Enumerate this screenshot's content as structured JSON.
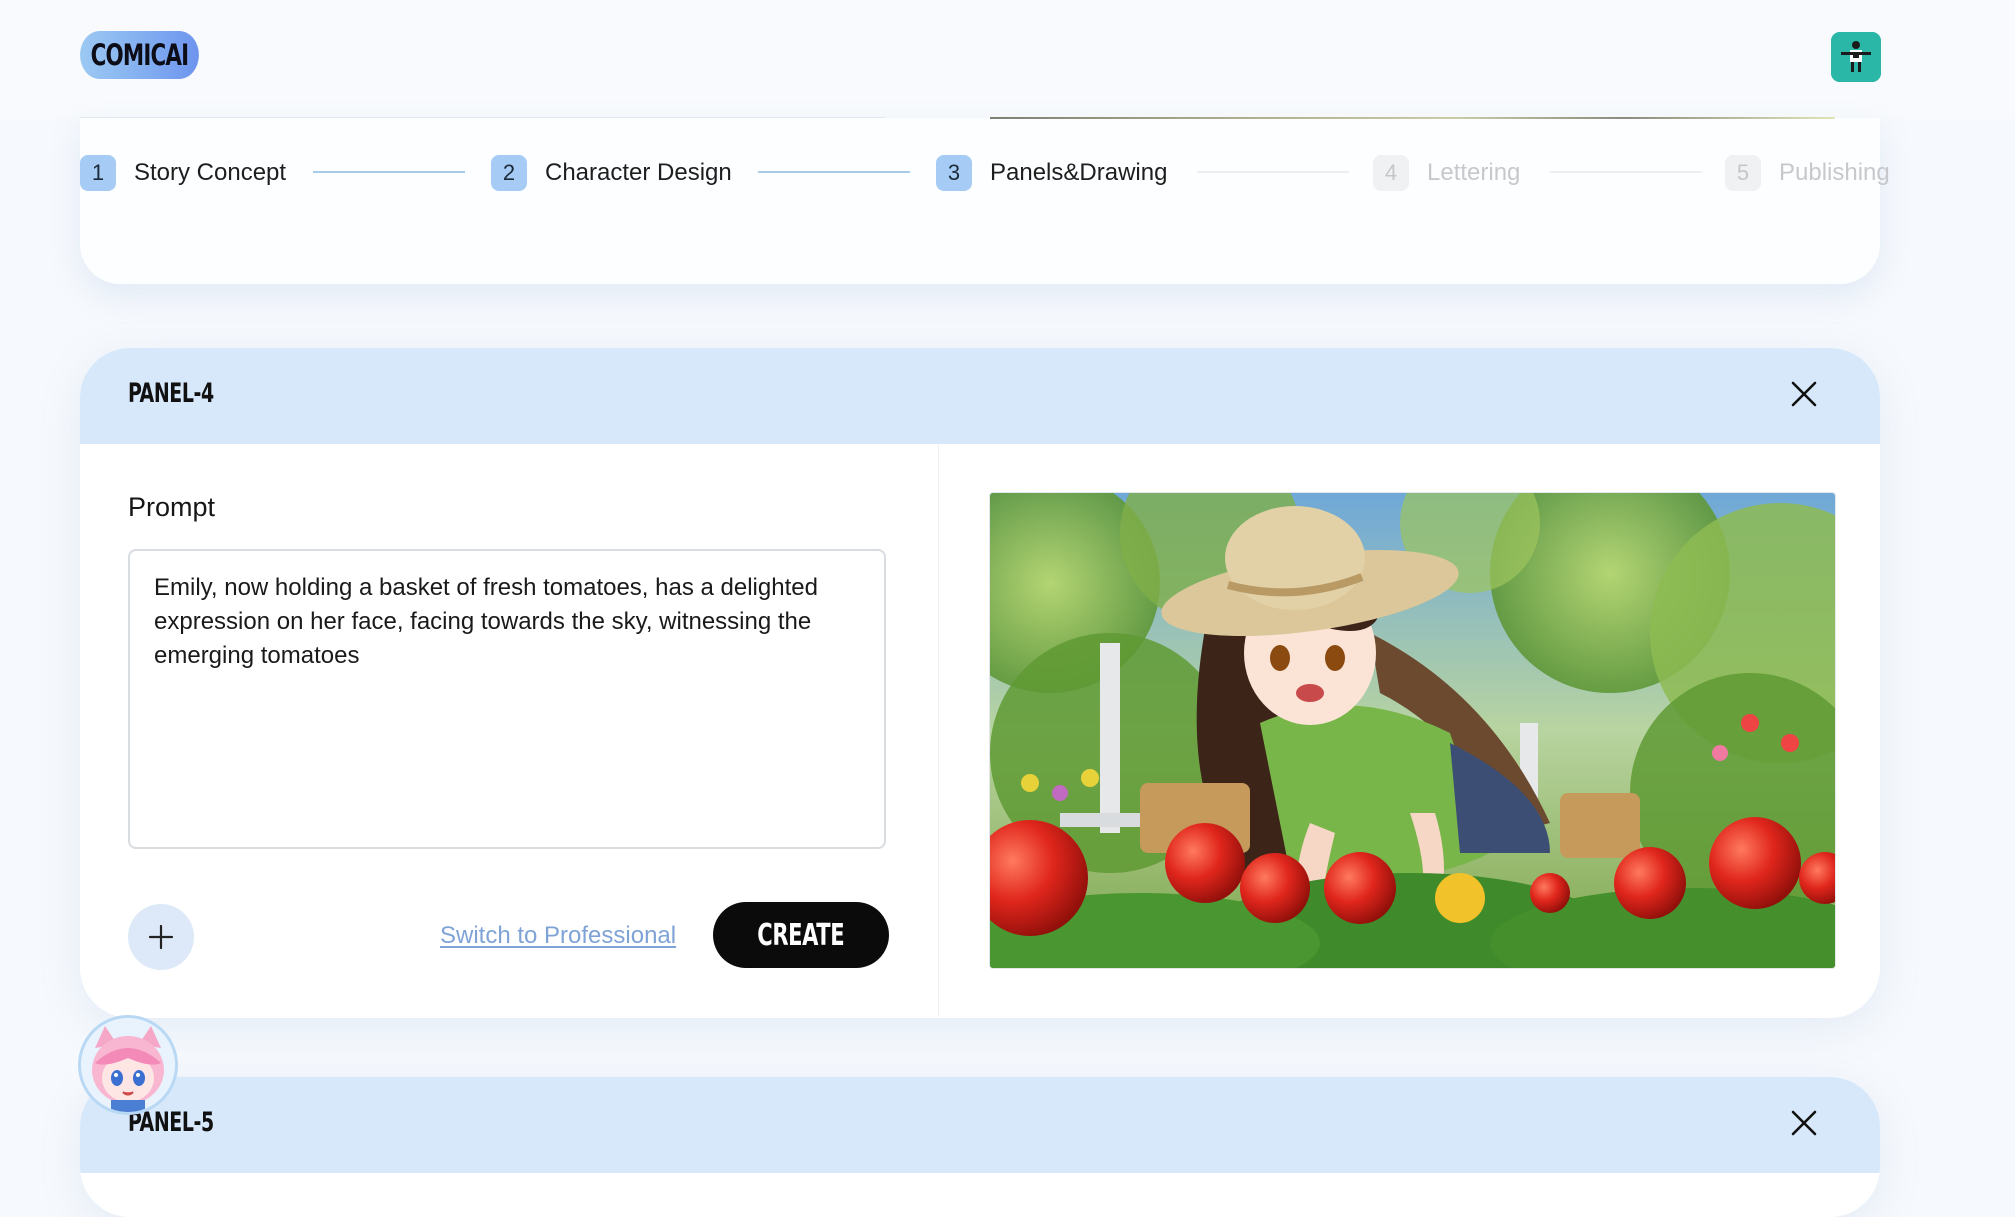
{
  "app": {
    "logo_text": "COMICAI"
  },
  "colors": {
    "accent_blue": "#a6ccf6",
    "panel_header": "#d8e8fb",
    "button_dark": "#0b0b0b",
    "link": "#7fa3d6"
  },
  "stepper": {
    "steps": [
      {
        "num": "1",
        "label": "Story Concept",
        "state": "active"
      },
      {
        "num": "2",
        "label": "Character Design",
        "state": "active"
      },
      {
        "num": "3",
        "label": "Panels&Drawing",
        "state": "active"
      },
      {
        "num": "4",
        "label": "Lettering",
        "state": "inactive"
      },
      {
        "num": "5",
        "label": "Publishing",
        "state": "inactive"
      }
    ]
  },
  "panel4": {
    "title": "PANEL-4",
    "prompt_label": "Prompt",
    "prompt_value": "Emily, now holding a basket of fresh tomatoes, has a delighted expression on her face, facing towards the sky, witnessing the emerging tomatoes",
    "switch_label": "Switch to Professional",
    "create_label": "CREATE",
    "image_icon": "anime-girl-tomato-garden-illustration"
  },
  "panel5": {
    "title": "PANEL-5"
  },
  "icons": {
    "close": "close-icon",
    "add": "plus-icon",
    "user": "user-avatar-icon",
    "mascot": "mascot-avatar-icon"
  }
}
